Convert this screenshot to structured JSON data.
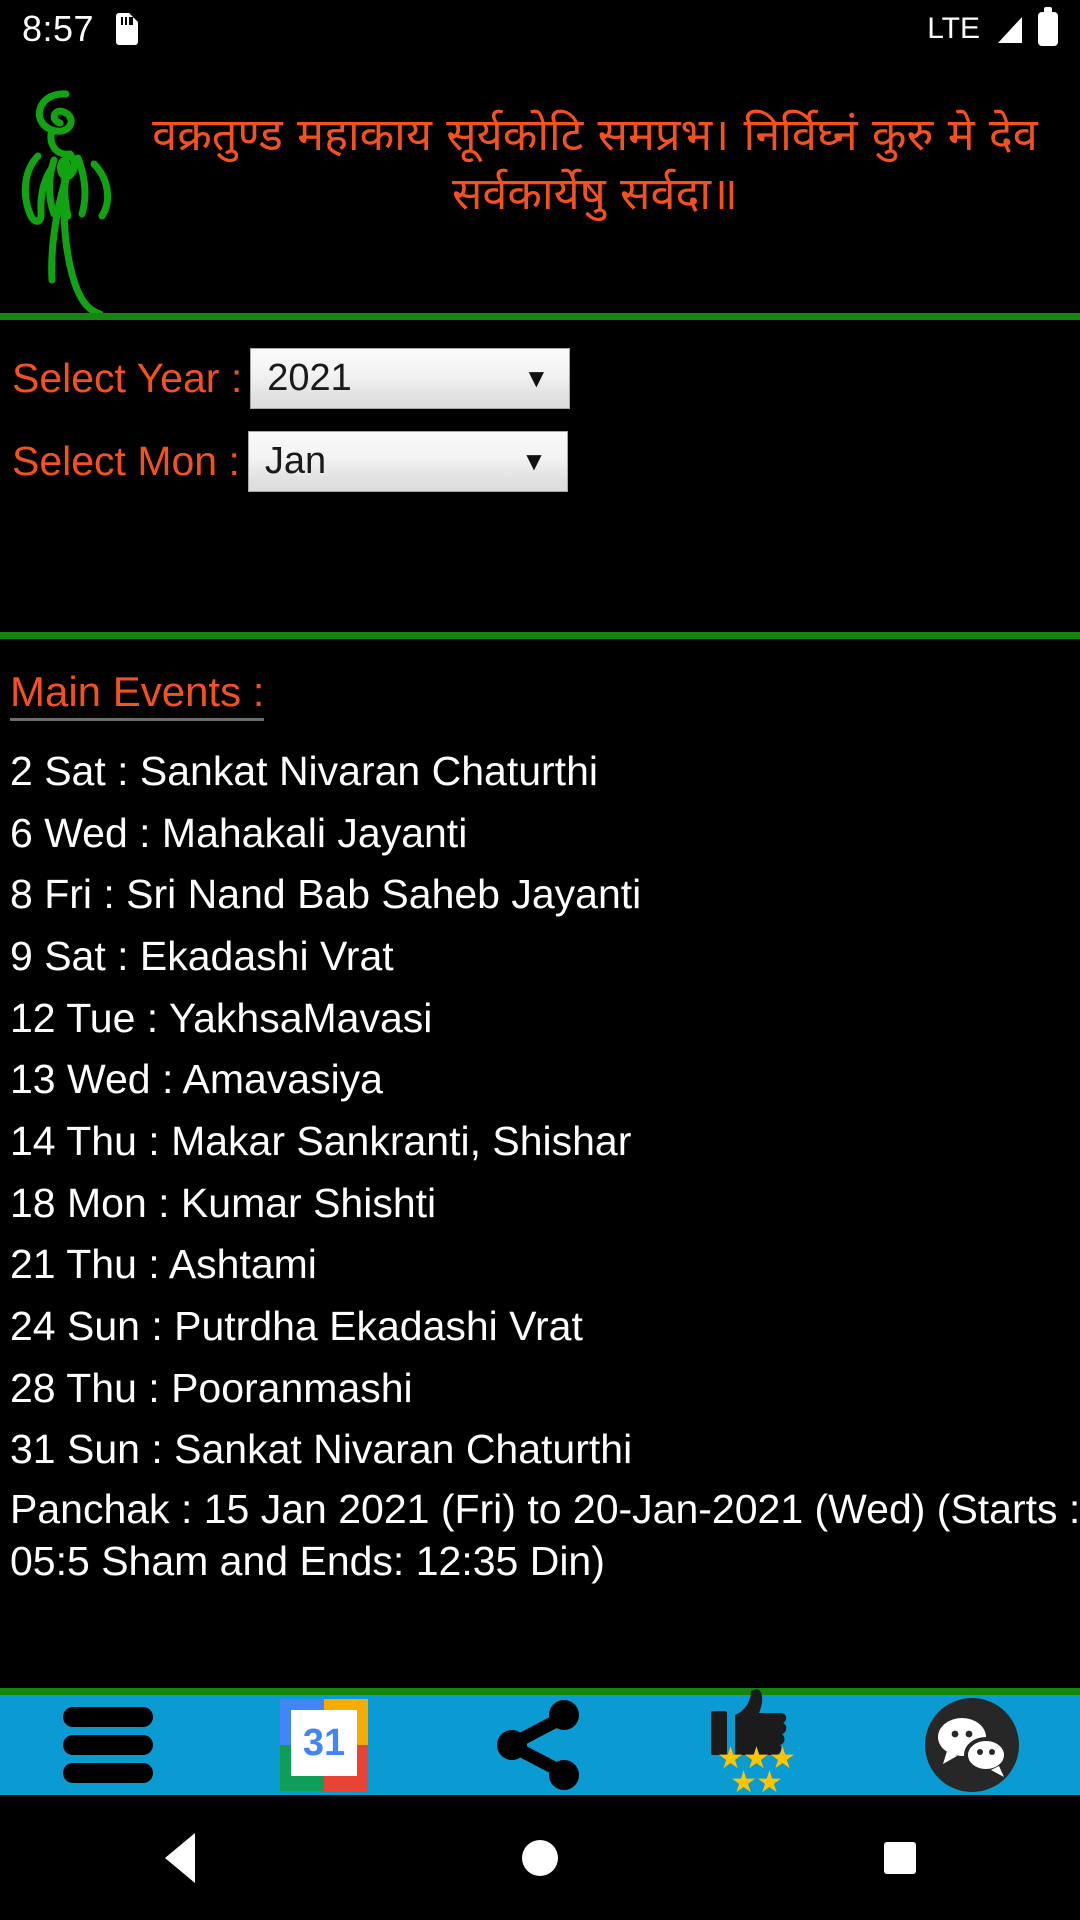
{
  "statusbar": {
    "time": "8:57",
    "sd_icon": "sd-card-icon",
    "network": "LTE",
    "signal_icon": "signal-bars-icon",
    "battery_icon": "battery-full-icon"
  },
  "header": {
    "logo_icon": "ganesha-logo-icon",
    "shloka": "वक्रतुण्ड महाकाय सूर्यकोटि समप्रभ। निर्विघ्नं कुरु मे देव सर्वकार्येषु सर्वदा॥",
    "shloka_color": "#F4511E",
    "divider_color": "#14850F"
  },
  "form": {
    "year": {
      "label": "Select Year :",
      "value": "2021",
      "arrow_icon": "chevron-down-icon"
    },
    "month": {
      "label": "Select Mon :",
      "value": "Jan",
      "arrow_icon": "chevron-down-icon"
    },
    "label_color": "#F4511E"
  },
  "events": {
    "title": "Main Events :",
    "title_color": "#F4511E",
    "items": [
      "2 Sat : Sankat Nivaran Chaturthi",
      "6 Wed : Mahakali Jayanti",
      "8 Fri : Sri Nand Bab Saheb Jayanti",
      "9 Sat : Ekadashi Vrat",
      "12 Tue : YakhsaMavasi",
      "13 Wed : Amavasiya",
      "14 Thu : Makar Sankranti, Shishar",
      "18 Mon : Kumar Shishti",
      "21 Thu : Ashtami",
      "24 Sun : Putrdha Ekadashi Vrat",
      "28 Thu : Pooranmashi",
      "31 Sun : Sankat Nivaran Chaturthi"
    ],
    "note": "Panchak : 15 Jan 2021 (Fri) to 20-Jan-2021 (Wed) (Starts : 05:5 Sham and Ends: 12:35 Din)"
  },
  "toolbar": {
    "background": "#0B9BD3",
    "items": [
      {
        "name": "menu",
        "icon": "hamburger-menu-icon"
      },
      {
        "name": "calendar",
        "icon": "google-calendar-icon",
        "day": "31"
      },
      {
        "name": "share",
        "icon": "share-icon"
      },
      {
        "name": "rate",
        "icon": "thumbs-up-icon",
        "stars": "★★★",
        "stars2": "★★"
      },
      {
        "name": "chat",
        "icon": "chat-bubbles-icon"
      }
    ]
  },
  "navbar": {
    "back": "back-nav-icon",
    "home": "home-nav-icon",
    "recent": "recent-apps-nav-icon"
  }
}
